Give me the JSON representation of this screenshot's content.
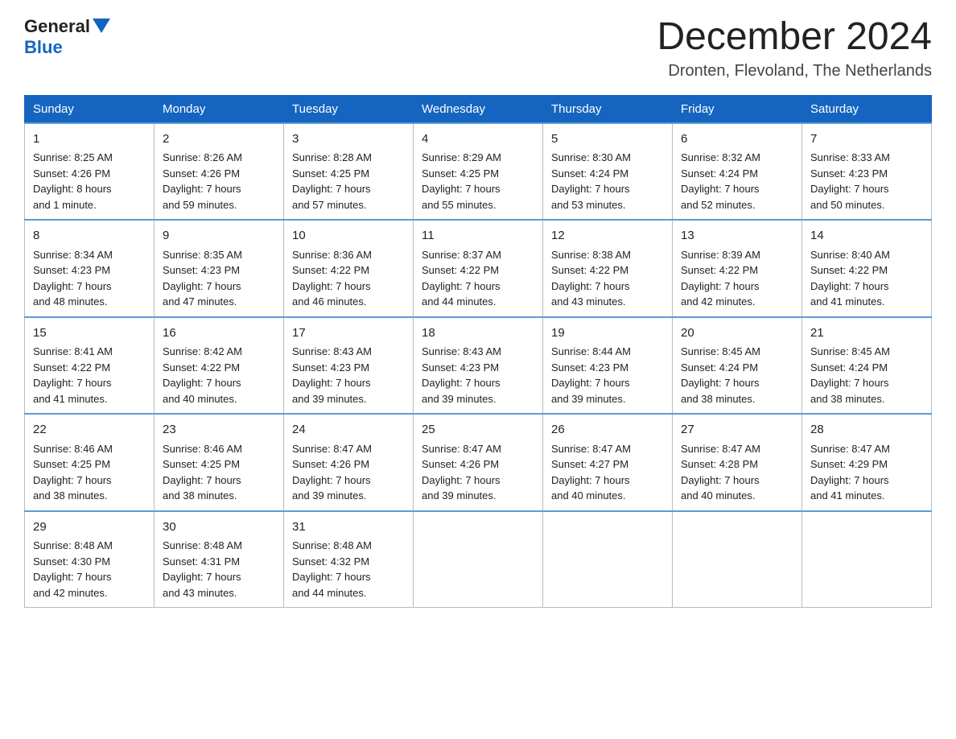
{
  "header": {
    "logo_general": "General",
    "logo_blue": "Blue",
    "month_title": "December 2024",
    "location": "Dronten, Flevoland, The Netherlands"
  },
  "days_of_week": [
    "Sunday",
    "Monday",
    "Tuesday",
    "Wednesday",
    "Thursday",
    "Friday",
    "Saturday"
  ],
  "weeks": [
    [
      {
        "day": "1",
        "info": "Sunrise: 8:25 AM\nSunset: 4:26 PM\nDaylight: 8 hours\nand 1 minute."
      },
      {
        "day": "2",
        "info": "Sunrise: 8:26 AM\nSunset: 4:26 PM\nDaylight: 7 hours\nand 59 minutes."
      },
      {
        "day": "3",
        "info": "Sunrise: 8:28 AM\nSunset: 4:25 PM\nDaylight: 7 hours\nand 57 minutes."
      },
      {
        "day": "4",
        "info": "Sunrise: 8:29 AM\nSunset: 4:25 PM\nDaylight: 7 hours\nand 55 minutes."
      },
      {
        "day": "5",
        "info": "Sunrise: 8:30 AM\nSunset: 4:24 PM\nDaylight: 7 hours\nand 53 minutes."
      },
      {
        "day": "6",
        "info": "Sunrise: 8:32 AM\nSunset: 4:24 PM\nDaylight: 7 hours\nand 52 minutes."
      },
      {
        "day": "7",
        "info": "Sunrise: 8:33 AM\nSunset: 4:23 PM\nDaylight: 7 hours\nand 50 minutes."
      }
    ],
    [
      {
        "day": "8",
        "info": "Sunrise: 8:34 AM\nSunset: 4:23 PM\nDaylight: 7 hours\nand 48 minutes."
      },
      {
        "day": "9",
        "info": "Sunrise: 8:35 AM\nSunset: 4:23 PM\nDaylight: 7 hours\nand 47 minutes."
      },
      {
        "day": "10",
        "info": "Sunrise: 8:36 AM\nSunset: 4:22 PM\nDaylight: 7 hours\nand 46 minutes."
      },
      {
        "day": "11",
        "info": "Sunrise: 8:37 AM\nSunset: 4:22 PM\nDaylight: 7 hours\nand 44 minutes."
      },
      {
        "day": "12",
        "info": "Sunrise: 8:38 AM\nSunset: 4:22 PM\nDaylight: 7 hours\nand 43 minutes."
      },
      {
        "day": "13",
        "info": "Sunrise: 8:39 AM\nSunset: 4:22 PM\nDaylight: 7 hours\nand 42 minutes."
      },
      {
        "day": "14",
        "info": "Sunrise: 8:40 AM\nSunset: 4:22 PM\nDaylight: 7 hours\nand 41 minutes."
      }
    ],
    [
      {
        "day": "15",
        "info": "Sunrise: 8:41 AM\nSunset: 4:22 PM\nDaylight: 7 hours\nand 41 minutes."
      },
      {
        "day": "16",
        "info": "Sunrise: 8:42 AM\nSunset: 4:22 PM\nDaylight: 7 hours\nand 40 minutes."
      },
      {
        "day": "17",
        "info": "Sunrise: 8:43 AM\nSunset: 4:23 PM\nDaylight: 7 hours\nand 39 minutes."
      },
      {
        "day": "18",
        "info": "Sunrise: 8:43 AM\nSunset: 4:23 PM\nDaylight: 7 hours\nand 39 minutes."
      },
      {
        "day": "19",
        "info": "Sunrise: 8:44 AM\nSunset: 4:23 PM\nDaylight: 7 hours\nand 39 minutes."
      },
      {
        "day": "20",
        "info": "Sunrise: 8:45 AM\nSunset: 4:24 PM\nDaylight: 7 hours\nand 38 minutes."
      },
      {
        "day": "21",
        "info": "Sunrise: 8:45 AM\nSunset: 4:24 PM\nDaylight: 7 hours\nand 38 minutes."
      }
    ],
    [
      {
        "day": "22",
        "info": "Sunrise: 8:46 AM\nSunset: 4:25 PM\nDaylight: 7 hours\nand 38 minutes."
      },
      {
        "day": "23",
        "info": "Sunrise: 8:46 AM\nSunset: 4:25 PM\nDaylight: 7 hours\nand 38 minutes."
      },
      {
        "day": "24",
        "info": "Sunrise: 8:47 AM\nSunset: 4:26 PM\nDaylight: 7 hours\nand 39 minutes."
      },
      {
        "day": "25",
        "info": "Sunrise: 8:47 AM\nSunset: 4:26 PM\nDaylight: 7 hours\nand 39 minutes."
      },
      {
        "day": "26",
        "info": "Sunrise: 8:47 AM\nSunset: 4:27 PM\nDaylight: 7 hours\nand 40 minutes."
      },
      {
        "day": "27",
        "info": "Sunrise: 8:47 AM\nSunset: 4:28 PM\nDaylight: 7 hours\nand 40 minutes."
      },
      {
        "day": "28",
        "info": "Sunrise: 8:47 AM\nSunset: 4:29 PM\nDaylight: 7 hours\nand 41 minutes."
      }
    ],
    [
      {
        "day": "29",
        "info": "Sunrise: 8:48 AM\nSunset: 4:30 PM\nDaylight: 7 hours\nand 42 minutes."
      },
      {
        "day": "30",
        "info": "Sunrise: 8:48 AM\nSunset: 4:31 PM\nDaylight: 7 hours\nand 43 minutes."
      },
      {
        "day": "31",
        "info": "Sunrise: 8:48 AM\nSunset: 4:32 PM\nDaylight: 7 hours\nand 44 minutes."
      },
      {
        "day": "",
        "info": ""
      },
      {
        "day": "",
        "info": ""
      },
      {
        "day": "",
        "info": ""
      },
      {
        "day": "",
        "info": ""
      }
    ]
  ]
}
